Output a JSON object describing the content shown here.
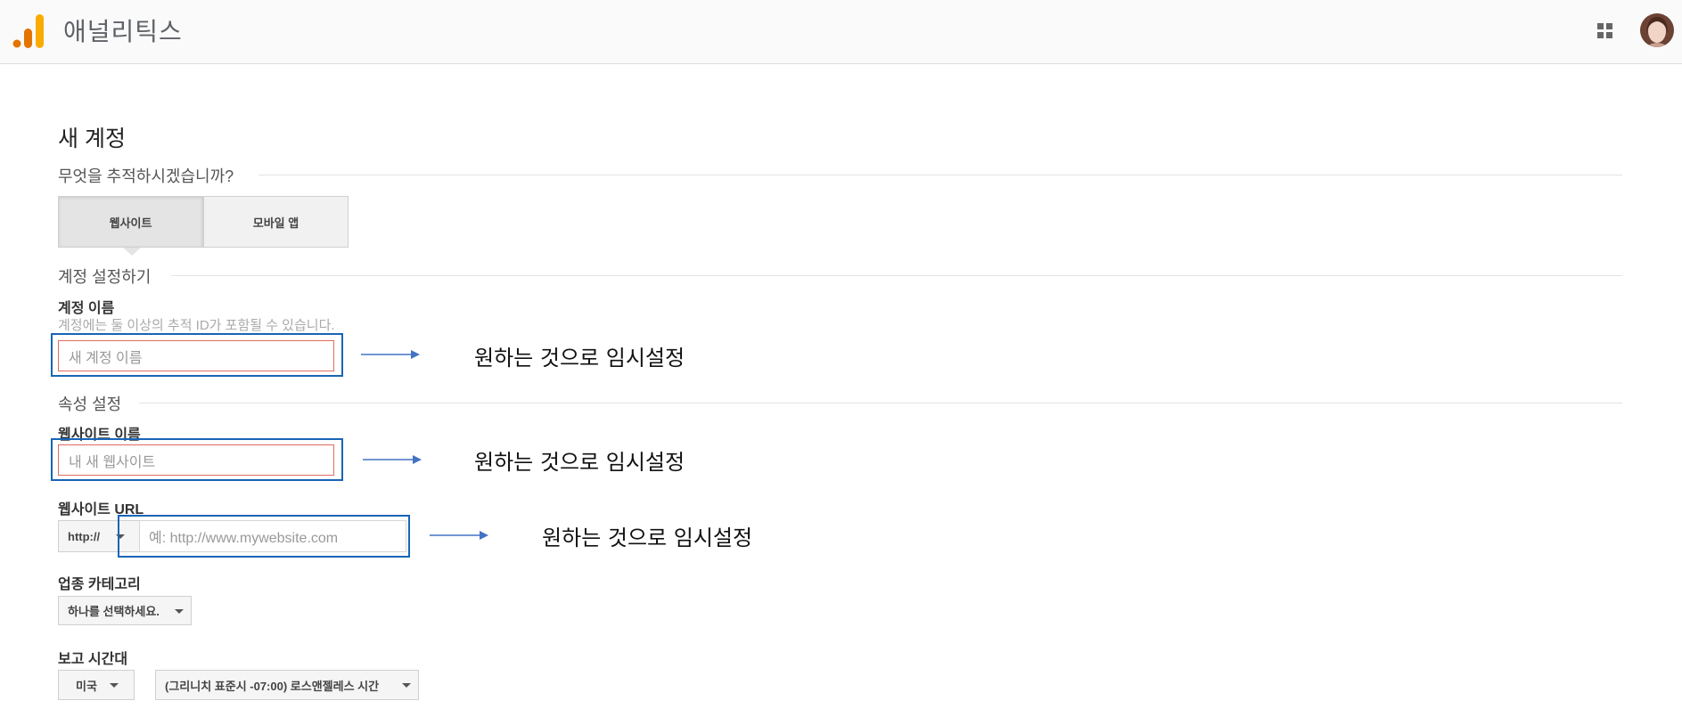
{
  "header": {
    "app_title": "애널리틱스",
    "brand_colors": [
      "#f9ab00",
      "#e37400"
    ],
    "apps_icon": "grid-icon",
    "avatar": "profile-avatar"
  },
  "page": {
    "title": "새 계정"
  },
  "tracking": {
    "question": "무엇을 추적하시겠습니까?",
    "options": [
      "웹사이트",
      "모바일 앱"
    ],
    "selected": "웹사이트"
  },
  "account": {
    "section_title": "계정 설정하기",
    "name_label": "계정 이름",
    "help_text": "계정에는 둘 이상의 추적 ID가 포함될 수 있습니다.",
    "name_placeholder": "새 계정 이름"
  },
  "property": {
    "section_title": "속성 설정",
    "website_name_label": "웹사이트 이름",
    "website_name_placeholder": "내 새 웹사이트",
    "url_label": "웹사이트 URL",
    "protocol": "http://",
    "url_placeholder": "예: http://www.mywebsite.com",
    "category_label": "업종 카테고리",
    "category_value": "하나를 선택하세요.",
    "timezone_label": "보고 시간대",
    "country_value": "미국",
    "timezone_value": "(그리니치 표준시 -07:00) 로스앤젤레스 시간"
  },
  "annotations": {
    "note_1": "원하는 것으로 임시설정",
    "note_2": "원하는 것으로 임시설정",
    "note_3": "원하는 것으로 임시설정",
    "highlight_color": "#1765b7",
    "arrow_color": "#4472c4"
  }
}
